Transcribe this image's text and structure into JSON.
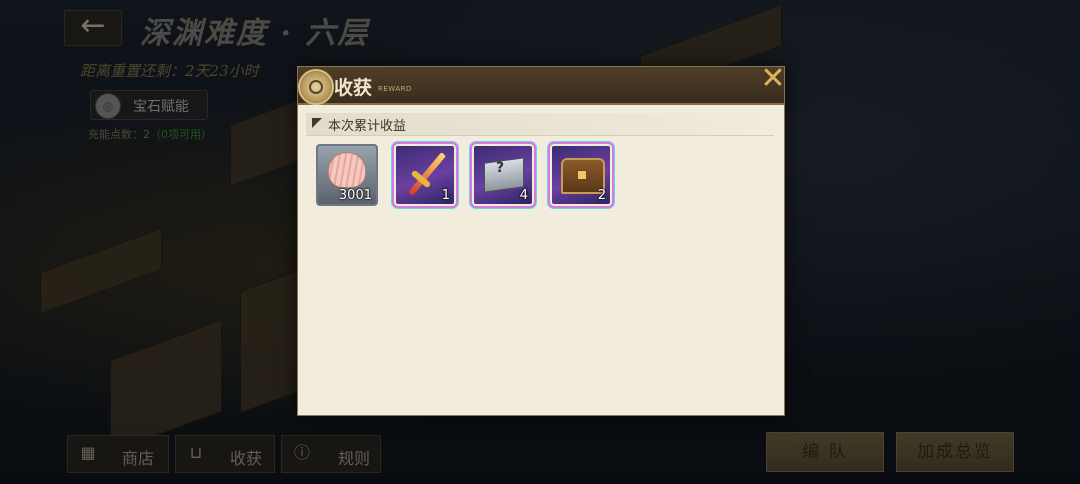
{
  "header": {
    "back_icon": "arrow-left-icon",
    "back_glyph": "←",
    "title": "深渊难度 · 六层",
    "reset_text": "距离重置还剩：2天23小时"
  },
  "sidebar": {
    "gem_button_label": "宝石赋能",
    "charge_prefix": "充能点数：2",
    "charge_available": "（0项可用）"
  },
  "modal": {
    "title": "收获",
    "subtitle": "REWARD",
    "close_glyph": "✕",
    "section_label": "本次累计收益",
    "items": [
      {
        "name": "shell-icon",
        "count": "3001",
        "frame": "grey"
      },
      {
        "name": "sword-icon",
        "count": "1",
        "frame": "rainbow"
      },
      {
        "name": "mystery-box-icon",
        "count": "4",
        "frame": "rainbow"
      },
      {
        "name": "treasure-chest-icon",
        "count": "2",
        "frame": "rainbow"
      }
    ]
  },
  "bottom_bar": {
    "shop_label": "商店",
    "harvest_label": "收获",
    "rules_label": "规则",
    "shop_icon": "shop-icon",
    "harvest_icon": "basket-icon",
    "rules_icon": "exclamation-icon",
    "team_label": "编 队",
    "bonus_label": "加成总览"
  }
}
